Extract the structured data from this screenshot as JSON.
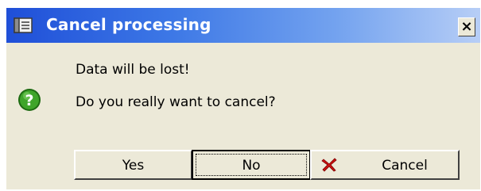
{
  "window": {
    "title": "Cancel processing",
    "title_icon": "window-icon",
    "close_label": "×",
    "close_icon": "close-icon"
  },
  "message": {
    "icon": "question-icon",
    "line1": "Data will be lost!",
    "line2": "Do you really want to cancel?"
  },
  "buttons": {
    "yes_label": "Yes",
    "no_label": "No",
    "cancel_label": "Cancel",
    "cancel_icon": "red-x-icon",
    "default_button": "No"
  },
  "colors": {
    "titlebar_start": "#1f4fd8",
    "titlebar_end": "#b7cef6",
    "dialog_face": "#ece9d8",
    "question_icon": "#2e8b1f",
    "cancel_icon": "#cc1111"
  }
}
